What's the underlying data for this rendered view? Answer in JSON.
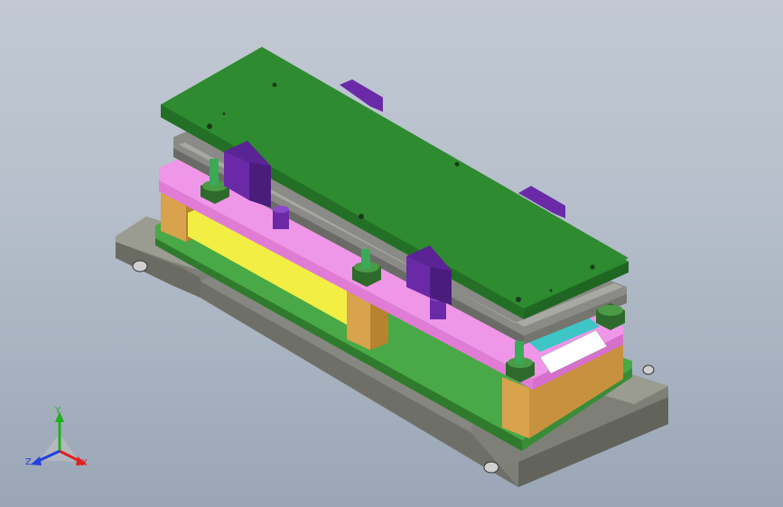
{
  "viewport": {
    "background_top": "#c2c9d3",
    "background_bottom": "#9aa6b6"
  },
  "model": {
    "parts": [
      "base-plate",
      "lower-die-shoe",
      "die-blocks",
      "punch-holder",
      "guide-bushings",
      "stripper-plate",
      "upper-die-shoe",
      "top-plate",
      "purple-brackets"
    ],
    "colors": {
      "base": "#8c8e84",
      "lower_shoe": "#4aa945",
      "block": "#d9a24d",
      "yellow": "#f2ee44",
      "pink": "#f096e8",
      "gray_plate": "#8a8b86",
      "top_plate": "#2b8a2e",
      "purple": "#6a2aa8"
    }
  },
  "triad": {
    "x_label": "X",
    "y_label": "Y",
    "z_label": "Z",
    "x_color": "#e02020",
    "y_color": "#20b020",
    "z_color": "#2040e0"
  }
}
